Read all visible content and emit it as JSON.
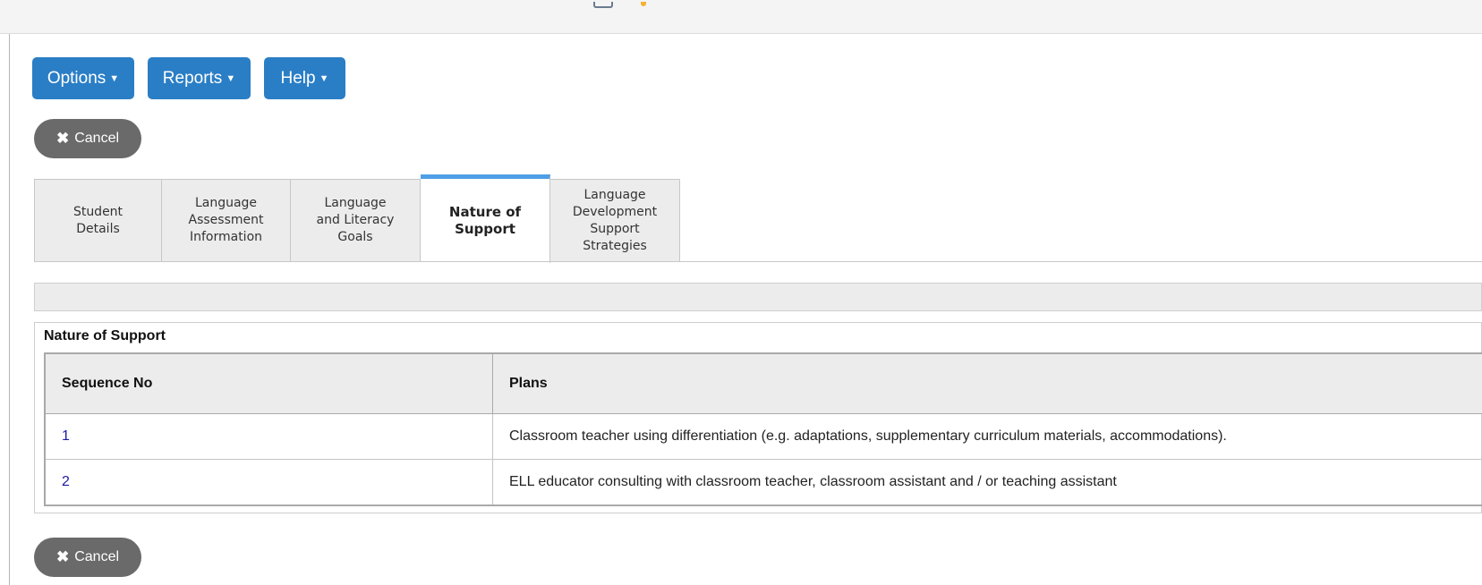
{
  "menu": {
    "options_label": "Options",
    "reports_label": "Reports",
    "help_label": "Help",
    "caret": "▼"
  },
  "cancel": {
    "icon": "✖",
    "label": "Cancel"
  },
  "tabs": [
    {
      "label": "Student\nDetails",
      "active": false
    },
    {
      "label": "Language\nAssessment\nInformation",
      "active": false
    },
    {
      "label": "Language\nand Literacy\nGoals",
      "active": false
    },
    {
      "label": "Nature of\nSupport",
      "active": true
    },
    {
      "label": "Language\nDevelopment\nSupport\nStrategies",
      "active": false
    }
  ],
  "section": {
    "title": "Nature of Support",
    "columns": [
      "Sequence No",
      "Plans"
    ],
    "rows": [
      {
        "seq": "1",
        "plan": "Classroom teacher using differentiation (e.g. adaptations, supplementary curriculum materials, accommodations)."
      },
      {
        "seq": "2",
        "plan": "ELL educator consulting with classroom teacher, classroom assistant and / or teaching assistant"
      }
    ]
  },
  "colors": {
    "primary_button": "#2a7ec6",
    "cancel_button": "#6a6a6a",
    "active_tab_accent": "#4f9fe6",
    "link": "#1a1aa6"
  }
}
